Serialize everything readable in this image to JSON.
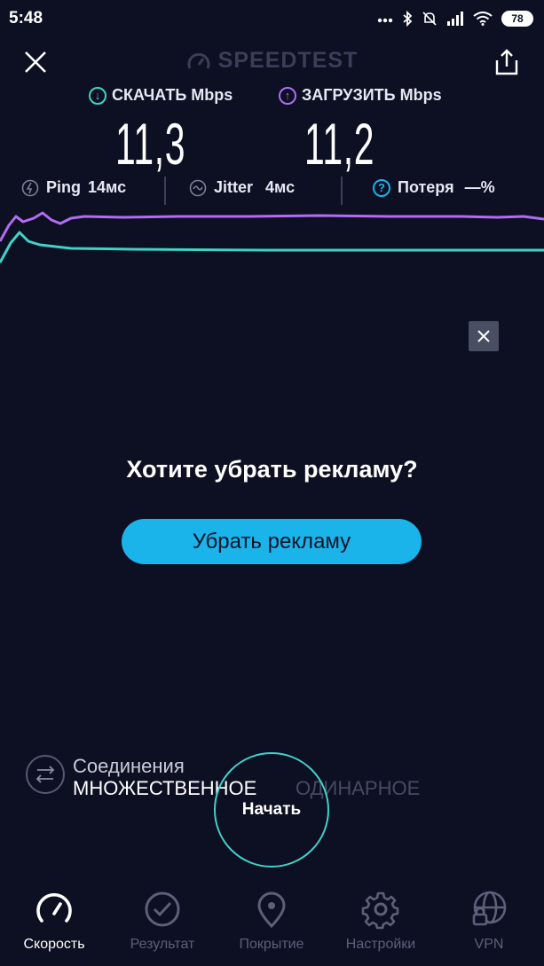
{
  "status_bar": {
    "time": "5:48",
    "battery": "78"
  },
  "header": {
    "brand": "SPEEDTEST"
  },
  "download": {
    "label": "СКАЧАТЬ Mbps",
    "value": "11,3",
    "color": "#3fd3c8"
  },
  "upload": {
    "label": "ЗАГРУЗИТЬ Mbps",
    "value": "11,2",
    "color": "#b06df2"
  },
  "stats": {
    "ping_label": "Ping",
    "ping_value": "14мс",
    "jitter_label": "Jitter",
    "jitter_value": "4мс",
    "loss_label": "Потеря",
    "loss_value": "—%"
  },
  "ad": {
    "title": "Хотите убрать рекламу?",
    "button": "Убрать рекламу"
  },
  "connections": {
    "title": "Соединения",
    "multi": "МНОЖЕСТВЕННОЕ",
    "single": "ОДИНАРНОЕ"
  },
  "start_button": "Начать",
  "nav": [
    {
      "label": "Скорость",
      "icon": "speedometer-icon",
      "active": true
    },
    {
      "label": "Результат",
      "icon": "check-circle-icon",
      "active": false
    },
    {
      "label": "Покрытие",
      "icon": "location-pin-icon",
      "active": false
    },
    {
      "label": "Настройки",
      "icon": "gear-icon",
      "active": false
    },
    {
      "label": "VPN",
      "icon": "globe-lock-icon",
      "active": false
    }
  ]
}
